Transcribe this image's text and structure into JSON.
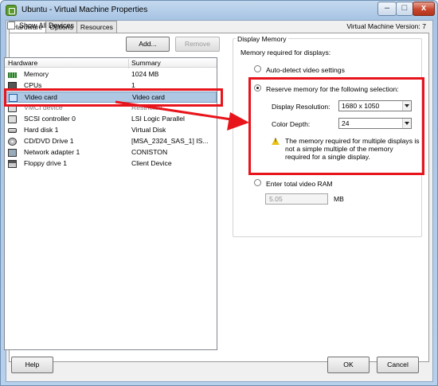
{
  "window": {
    "title": "Ubuntu - Virtual Machine Properties",
    "controls": {
      "minimize": "–",
      "maximize": "□",
      "close": "x"
    }
  },
  "tabs": [
    {
      "label": "Hardware",
      "active": true
    },
    {
      "label": "Options",
      "active": false
    },
    {
      "label": "Resources",
      "active": false
    }
  ],
  "vm_version": "Virtual Machine Version: 7",
  "show_all_devices": {
    "label": "Show All Devices",
    "checked": false
  },
  "buttons": {
    "add": "Add...",
    "remove": "Remove",
    "help": "Help",
    "ok": "OK",
    "cancel": "Cancel"
  },
  "hardware_list": {
    "columns": [
      "Hardware",
      "Summary"
    ],
    "rows": [
      {
        "name": "Memory",
        "summary": "1024 MB",
        "icon": "memory-icon"
      },
      {
        "name": "CPUs",
        "summary": "1",
        "icon": "cpu-icon"
      },
      {
        "name": "Video card",
        "summary": "Video card",
        "icon": "video-card-icon",
        "selected": true
      },
      {
        "name": "VMCI device",
        "summary": "Restricted",
        "icon": "vmci-device-icon"
      },
      {
        "name": "SCSI controller 0",
        "summary": "LSI Logic Parallel",
        "icon": "scsi-controller-icon"
      },
      {
        "name": "Hard disk 1",
        "summary": "Virtual Disk",
        "icon": "hard-disk-icon"
      },
      {
        "name": "CD/DVD Drive 1",
        "summary": "[MSA_2324_SAS_1] IS...",
        "icon": "cd-dvd-drive-icon"
      },
      {
        "name": "Network adapter 1",
        "summary": "CONISTON",
        "icon": "network-adapter-icon"
      },
      {
        "name": "Floppy drive 1",
        "summary": "Client Device",
        "icon": "floppy-drive-icon"
      }
    ]
  },
  "display_memory": {
    "group_label": "Display Memory",
    "required_label": "Memory required for displays:",
    "auto_detect_label": "Auto-detect video settings",
    "reserve_label": "Reserve memory for the following selection:",
    "resolution_label": "Display Resolution:",
    "resolution_value": "1680 x 1050",
    "color_depth_label": "Color Depth:",
    "color_depth_value": "24",
    "warning_text": "The memory required for multiple displays is\nnot a simple multiple of the memory\nrequired for a single display.",
    "enter_ram_label": "Enter total video RAM",
    "ram_value": "5.05",
    "ram_unit": "MB",
    "selected_option": "reserve"
  },
  "colors": {
    "highlight": "#e8141c",
    "selection": "#aec8e3"
  }
}
